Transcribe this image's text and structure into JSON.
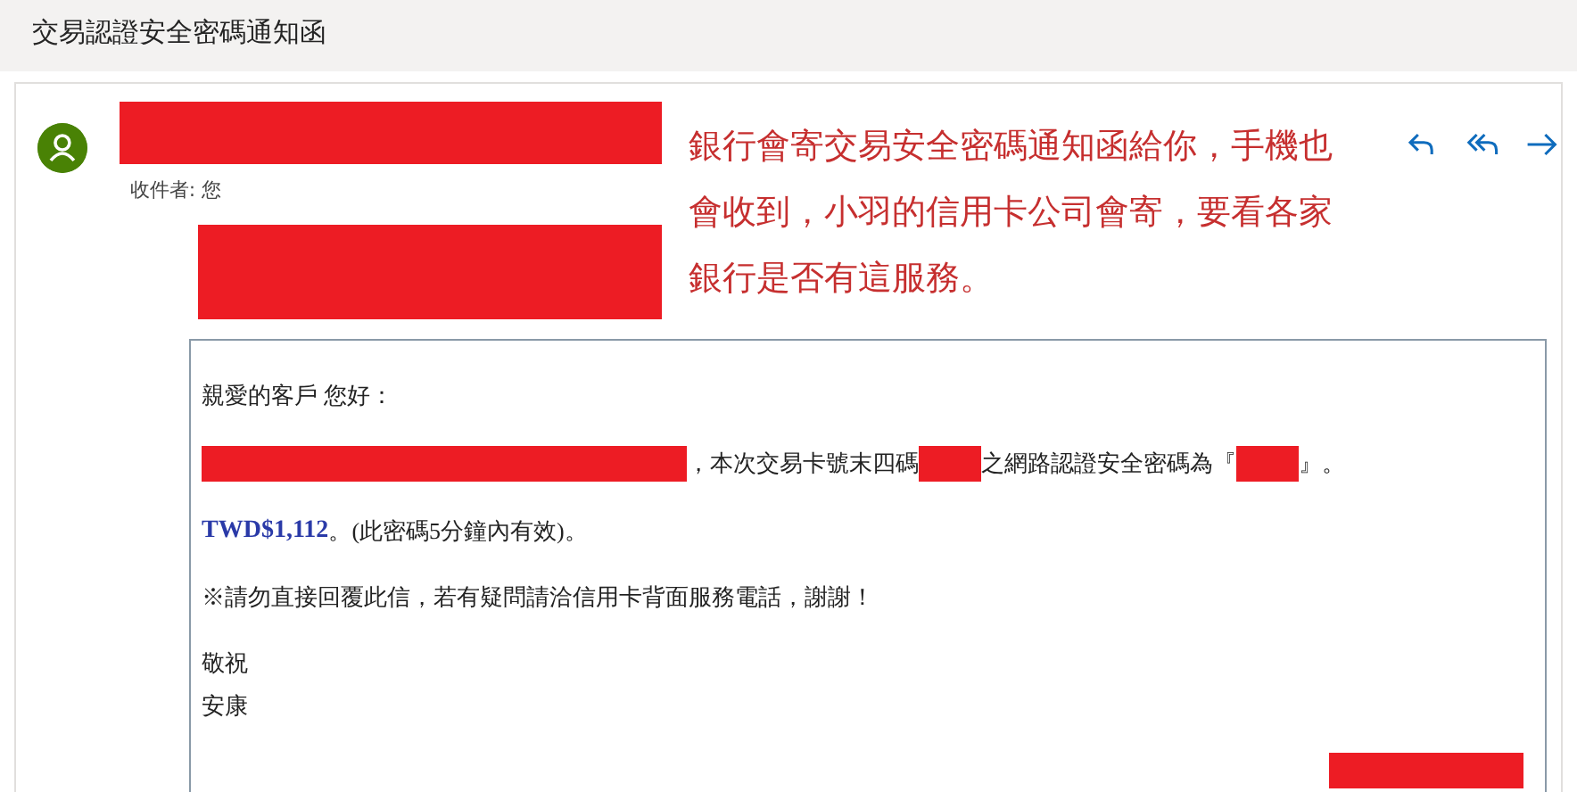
{
  "subject": "交易認證安全密碼通知函",
  "message": {
    "sender": {
      "kind": "redacted"
    },
    "recipient_label": "收件者:",
    "recipient": "您",
    "sender_detail": {
      "kind": "redacted"
    },
    "annotation": "銀行會寄交易安全密碼通知函給你，手機也會收到，小羽的信用卡公司會寄，要看各家銀行是否有這服務。",
    "actions": [
      {
        "kind": "reply"
      },
      {
        "kind": "reply-all"
      },
      {
        "kind": "forward"
      }
    ]
  },
  "body": {
    "paragraphs": [
      {
        "kind": "plain",
        "segments": [
          {
            "kind": "text",
            "text": "親愛的客戶 您好："
          }
        ]
      },
      {
        "kind": "plain",
        "segments": [
          {
            "kind": "redacted-wide"
          },
          {
            "kind": "text",
            "text": "，本次交易卡號末四碼"
          },
          {
            "kind": "redacted-narrow"
          },
          {
            "kind": "text",
            "text": "之網路認證安全密碼為『"
          },
          {
            "kind": "redacted-narrow"
          },
          {
            "kind": "text",
            "text": "』。"
          }
        ]
      },
      {
        "kind": "plain",
        "segments": [
          {
            "kind": "amount",
            "text": "TWD$1,112"
          },
          {
            "kind": "text",
            "text": "。(此密碼5分鐘內有效)。"
          }
        ]
      },
      {
        "kind": "plain",
        "segments": [
          {
            "kind": "text",
            "text": "※請勿直接回覆此信，若有疑問請洽信用卡背面服務電話，謝謝！"
          }
        ]
      },
      {
        "kind": "closing",
        "segments": [
          {
            "kind": "text",
            "text": "敬祝"
          }
        ]
      },
      {
        "kind": "closing",
        "segments": [
          {
            "kind": "text",
            "text": "安康"
          }
        ]
      }
    ],
    "signature": {
      "kind": "redacted"
    }
  }
}
